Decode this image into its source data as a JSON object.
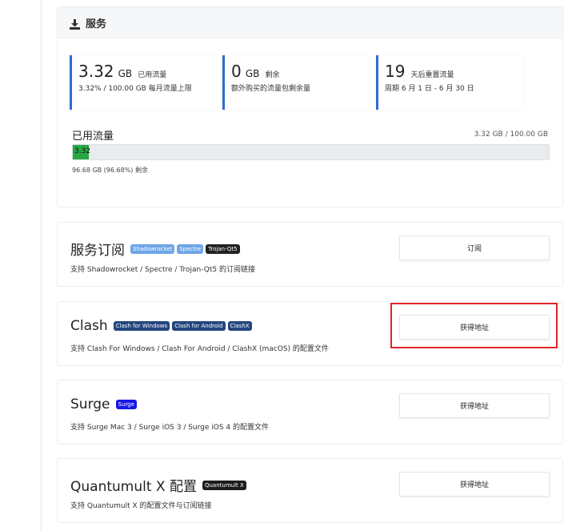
{
  "service": {
    "title": "服务",
    "stats": [
      {
        "value": "3.32",
        "unit": "GB",
        "label": "已用流量",
        "sub": "3.32% / 100.00 GB 每月流量上限"
      },
      {
        "value": "0",
        "unit": "GB",
        "label": "剩余",
        "sub": "额外购买的流量包剩余量"
      },
      {
        "value": "19",
        "unit": "",
        "label": "天后重置流量",
        "sub": "周期 6 月 1 日 - 6 月 30 日"
      }
    ],
    "usage": {
      "title": "已用流量",
      "summary": "3.32 GB / 100.00 GB",
      "bar_label": "3.32",
      "used_fraction": 0.0332,
      "remaining": "96.68 GB (96.68%) 剩余"
    }
  },
  "subscriptions": [
    {
      "name": "服务订阅",
      "badges": [
        {
          "text": "Shadowrocket",
          "color": "#6ea5e8"
        },
        {
          "text": "Spectre",
          "color": "#6ea5e8"
        },
        {
          "text": "Trojan-Qt5",
          "color": "#222222"
        }
      ],
      "description": "支持 Shadowrocket / Spectre / Trojan-Qt5 的订阅链接",
      "button": "订阅"
    },
    {
      "name": "Clash",
      "badges": [
        {
          "text": "Clash for Windows",
          "color": "#24467f"
        },
        {
          "text": "Clash for Android",
          "color": "#24467f"
        },
        {
          "text": "ClashX",
          "color": "#24467f"
        }
      ],
      "description": "支持 Clash For Windows / Clash For Android / ClashX (macOS) 的配置文件",
      "button": "获得地址"
    },
    {
      "name": "Surge",
      "badges": [
        {
          "text": "Surge",
          "color": "#1717e6"
        }
      ],
      "description": "支持 Surge Mac 3 / Surge iOS 3 / Surge iOS 4 的配置文件",
      "button": "获得地址"
    },
    {
      "name": "Quantumult X 配置",
      "badges": [
        {
          "text": "Quantumult X",
          "color": "#1c1c1c"
        }
      ],
      "description": "支持 Quantumult X 的配置文件与订阅链接",
      "button": "获得地址"
    }
  ]
}
